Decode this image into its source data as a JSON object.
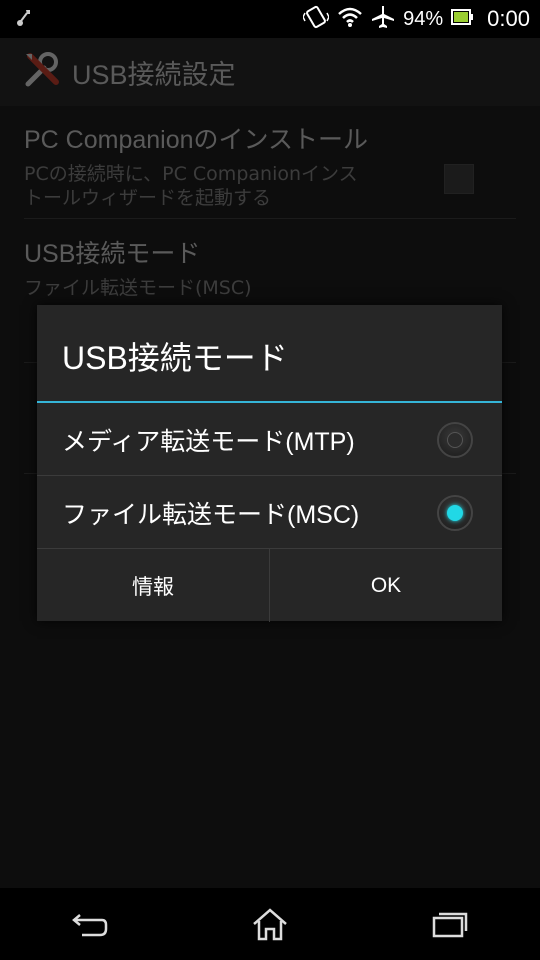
{
  "status_bar": {
    "battery_percent": "94%",
    "time": "0:00"
  },
  "action_bar": {
    "title": "USB接続設定"
  },
  "preferences": [
    {
      "title": "PC Companionのインストール",
      "summary_line1": "PCの接続時に、PC Companionインス",
      "summary_line2": "トールウィザードを起動する",
      "checked": false
    },
    {
      "title": "USB接続モード",
      "summary": "ファイル転送モード(MSC)"
    }
  ],
  "dialog": {
    "title": "USB接続モード",
    "options": [
      {
        "label": "メディア転送モード(MTP)",
        "selected": false
      },
      {
        "label": "ファイル転送モード(MSC)",
        "selected": true
      }
    ],
    "buttons": {
      "info": "情報",
      "ok": "OK"
    },
    "accent_color": "#35b5d8"
  }
}
